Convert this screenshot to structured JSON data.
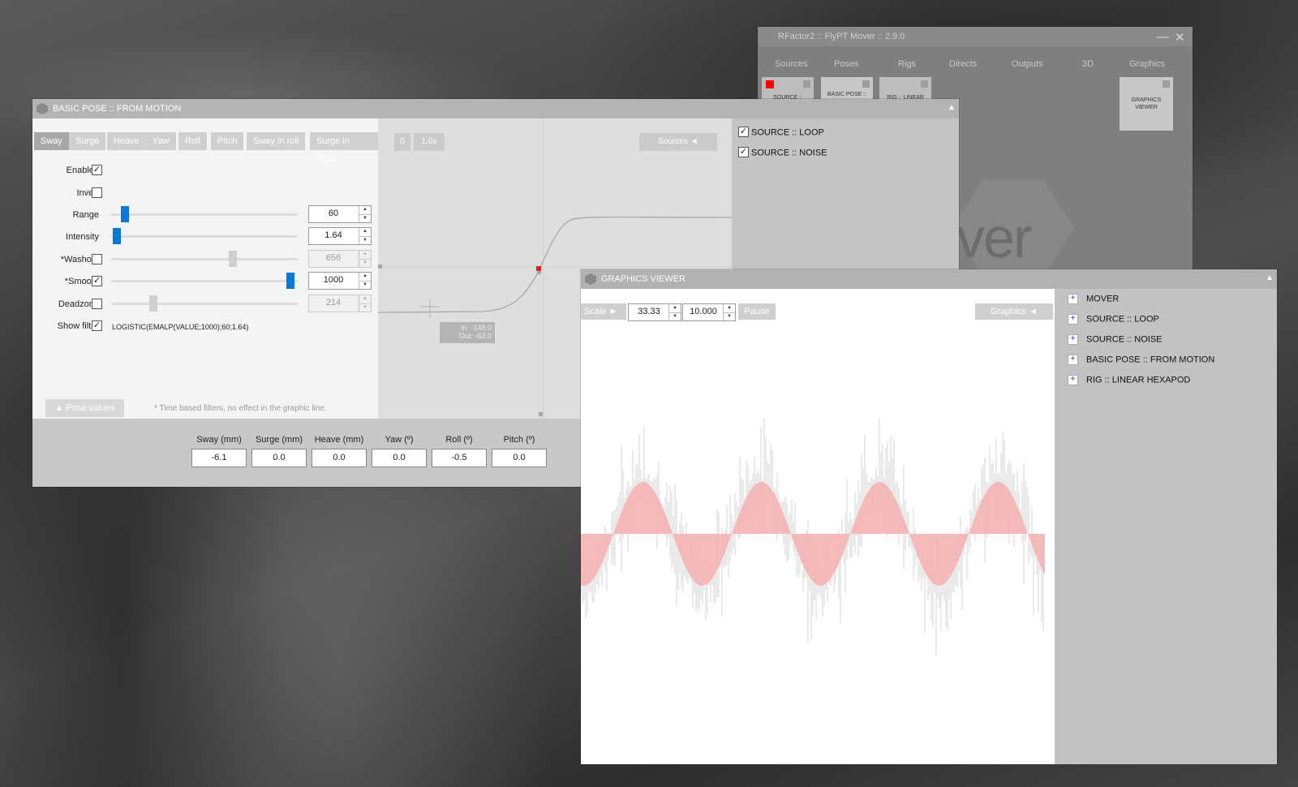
{
  "mover_window": {
    "title": "RFactor2 :: FlyPT Mover :: 2.9.0",
    "minimize": "—",
    "close": "✕",
    "tabs": [
      "Sources",
      "Poses",
      "Rigs",
      "Directs",
      "Outputs",
      "3D",
      "Graphics"
    ],
    "tiles": [
      {
        "label": "SOURCE ::",
        "status_color": "#ff0000"
      },
      {
        "label": "BASIC POSE ::"
      },
      {
        "label": "RIG :: LINEAR"
      },
      {
        "label": "GRAPHICS VIEWER"
      }
    ],
    "watermark": "ver"
  },
  "pose_window": {
    "title": "BASIC POSE :: FROM MOTION",
    "collapse": "▲",
    "tabs": [
      "Sway",
      "Surge",
      "Heave",
      "Yaw",
      "Roll",
      "Pitch",
      "Sway in roll",
      "Surge in Pitch"
    ],
    "active_tab": "Sway",
    "rows": [
      {
        "label": "Enabled",
        "checked": true
      },
      {
        "label": "Invert",
        "checked": false
      },
      {
        "label": "Range",
        "value": "60",
        "level": 0.08
      },
      {
        "label": "Intensity",
        "value": "1.64",
        "level": 0.04
      },
      {
        "label": "*Washout",
        "checked": false,
        "value": "656",
        "level": 0.65
      },
      {
        "label": "*Smooth",
        "checked": true,
        "value": "1000",
        "level": 1.0
      },
      {
        "label": "Deadzone",
        "checked": false,
        "value": "214",
        "level": 0.21
      },
      {
        "label": "Show filter",
        "checked": true
      }
    ],
    "filter_expression": "LOGISTIC(EMALP(VALUE;1000);60;1.64)",
    "pose_values_tab": "▲   Pose values",
    "note": "* Time based filters, no effect in the graphic line.",
    "graph_buttons": {
      "zero": "0",
      "zoom": "1.0x",
      "sources": "Sources   ◄"
    },
    "io_readout": {
      "in": "In: -148.0",
      "out": "Out: -62.0"
    },
    "sources": [
      "SOURCE :: LOOP",
      "SOURCE :: NOISE"
    ],
    "pose_values": [
      {
        "label": "Sway (mm)",
        "value": "-6.1"
      },
      {
        "label": "Surge (mm)",
        "value": "0.0"
      },
      {
        "label": "Heave (mm)",
        "value": "0.0"
      },
      {
        "label": "Yaw (º)",
        "value": "0.0"
      },
      {
        "label": "Roll (º)",
        "value": "-0.5"
      },
      {
        "label": "Pitch (º)",
        "value": "0.0"
      }
    ]
  },
  "graphics_viewer": {
    "title": "GRAPHICS VIEWER",
    "collapse": "▲",
    "scale_label": "Scale   ►",
    "scale_value": "33.33",
    "second_value": "10.000",
    "pause": "Pause",
    "graphics_button": "Graphics   ◄",
    "items": [
      "MOVER",
      "SOURCE :: LOOP",
      "SOURCE :: NOISE",
      "BASIC POSE :: FROM MOTION",
      "RIG :: LINEAR HEXAPOD"
    ],
    "colors": {
      "sine_fill": "#f4b2b2",
      "noise": "#d6d6d6"
    }
  }
}
